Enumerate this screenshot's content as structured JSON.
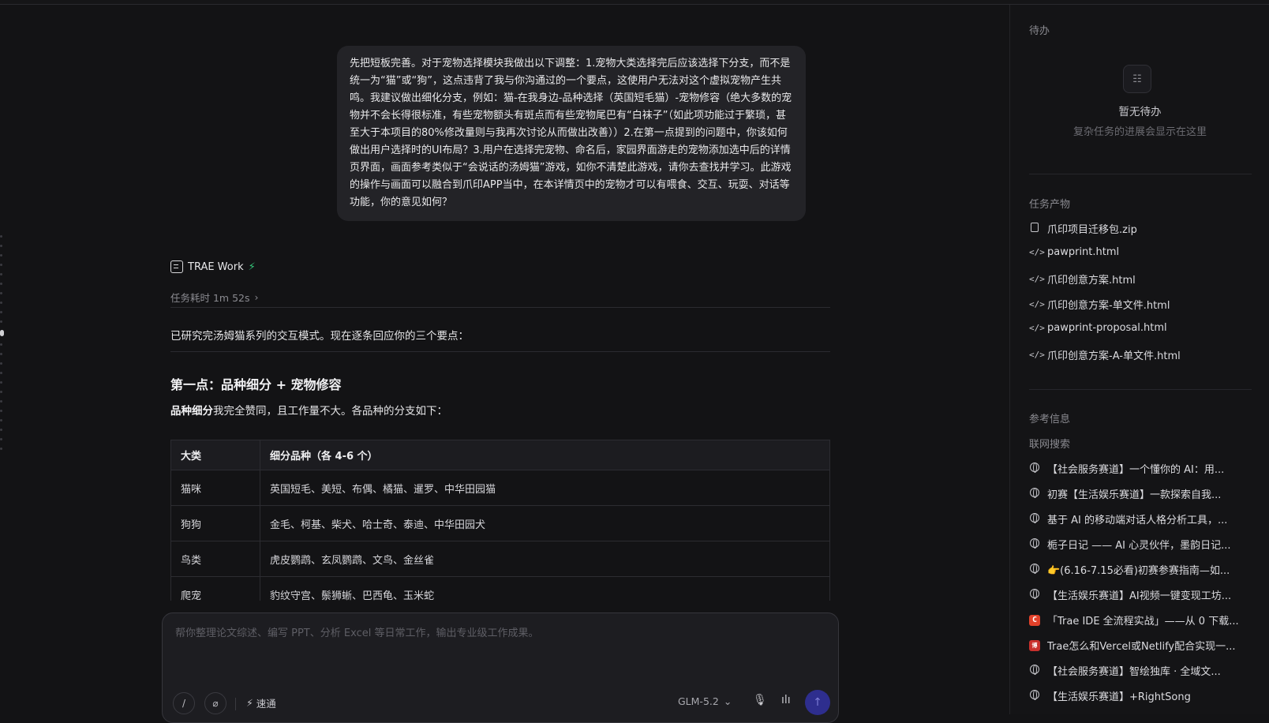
{
  "chat": {
    "user_message": "先把短板完善。对于宠物选择模块我做出以下调整：1.宠物大类选择完后应该选择下分支，而不是统一为“猫”或“狗”，这点违背了我与你沟通过的一个要点，这使用户无法对这个虚拟宠物产生共鸣。我建议做出细化分支，例如：猫-在我身边-品种选择（英国短毛猫）-宠物修容（绝大多数的宠物并不会长得很标准，有些宠物额头有斑点而有些宠物尾巴有“白袜子”（如此项功能过于繁琐，甚至大于本项目的80%修改量则与我再次讨论从而做出改善））2.在第一点提到的问题中，你该如何做出用户选择时的UI布局？3.用户在选择完宠物、命名后，家园界面游走的宠物添加选中后的详情页界面，画面参考类似于“会说话的汤姆猫”游戏，如你不清楚此游戏，请你去查找并学习。此游戏的操作与画面可以融合到爪印APP当中，在本详情页中的宠物才可以有喂食、交互、玩耍、对话等功能，你的意见如何？",
    "agent_name": "TRAE Work",
    "task_time": "任务耗时 1m 52s",
    "task_time_chevron": "›",
    "reply_intro": "已研究完汤姆猫系列的交互模式。现在逐条回应你的三个要点：",
    "section1_title": "第一点：品种细分 + 宠物修容",
    "section1_bold": "品种细分",
    "section1_rest": "我完全赞同，且工作量不大。各品种的分支如下：",
    "table": {
      "headers": [
        "大类",
        "细分品种（各 4-6 个）"
      ],
      "rows": [
        [
          "猫咪",
          "英国短毛、美短、布偶、橘猫、暹罗、中华田园猫"
        ],
        [
          "狗狗",
          "金毛、柯基、柴犬、哈士奇、泰迪、中华田园犬"
        ],
        [
          "鸟类",
          "虎皮鹦鹉、玄凤鹦鹉、文鸟、金丝雀"
        ],
        [
          "爬宠",
          "豹纹守宫、鬃狮蜥、巴西龟、玉米蛇"
        ]
      ]
    }
  },
  "composer": {
    "placeholder": "帮你整理论文综述、编写 PPT、分析 Excel 等日常工作，输出专业级工作成果。",
    "speed_label": "速通",
    "model_label": "GLM-5.2",
    "model_chevron": "⌄"
  },
  "side": {
    "todo_title": "待办",
    "todo_empty": "暂无待办",
    "todo_hint": "复杂任务的进展会显示在这里",
    "artifacts_title": "任务产物",
    "artifacts": [
      {
        "icon": "file-icon",
        "label": "爪印项目迁移包.zip"
      },
      {
        "icon": "code-icon",
        "label": "pawprint.html"
      },
      {
        "icon": "code-icon",
        "label": "爪印创意方案.html"
      },
      {
        "icon": "code-icon",
        "label": "爪印创意方案-单文件.html"
      },
      {
        "icon": "code-icon",
        "label": "pawprint-proposal.html"
      },
      {
        "icon": "code-icon",
        "label": "爪印创意方案-A-单文件.html"
      }
    ],
    "ref_title": "参考信息",
    "web_title": "联网搜索",
    "refs": [
      {
        "icon": "globe-icon",
        "label": "【社会服务赛道】一个懂你的 AI：用..."
      },
      {
        "icon": "globe-icon",
        "label": "初赛【生活娱乐赛道】一款探索自我..."
      },
      {
        "icon": "globe-icon",
        "label": "基于 AI 的移动端对话人格分析工具，..."
      },
      {
        "icon": "globe-icon",
        "label": "栀子日记 —— AI 心灵伙伴，墨韵日记..."
      },
      {
        "icon": "globe-icon",
        "label": "👉(6.16-7.15必看)初赛参赛指南—如..."
      },
      {
        "icon": "globe-icon",
        "label": "【生活娱乐赛道】AI视频一键变现工坊..."
      },
      {
        "icon": "csdn-icon",
        "label": "「Trae IDE 全流程实战」——从 0 下载..."
      },
      {
        "icon": "cnblogs-icon",
        "label": "Trae怎么和Vercel或Netlify配合实现一..."
      },
      {
        "icon": "globe-icon",
        "label": "【社会服务赛道】智绘独库 · 全域文..."
      },
      {
        "icon": "globe-icon",
        "label": "【生活娱乐赛道】+RightSong"
      }
    ]
  },
  "icons": {
    "code": "</>",
    "bolt": "⚡",
    "slash": "/",
    "attach": "⌀",
    "mic": "🎙",
    "wave": "ılı",
    "send": "↑",
    "list": "☷",
    "csdn": "C",
    "cnblogs": "博"
  }
}
